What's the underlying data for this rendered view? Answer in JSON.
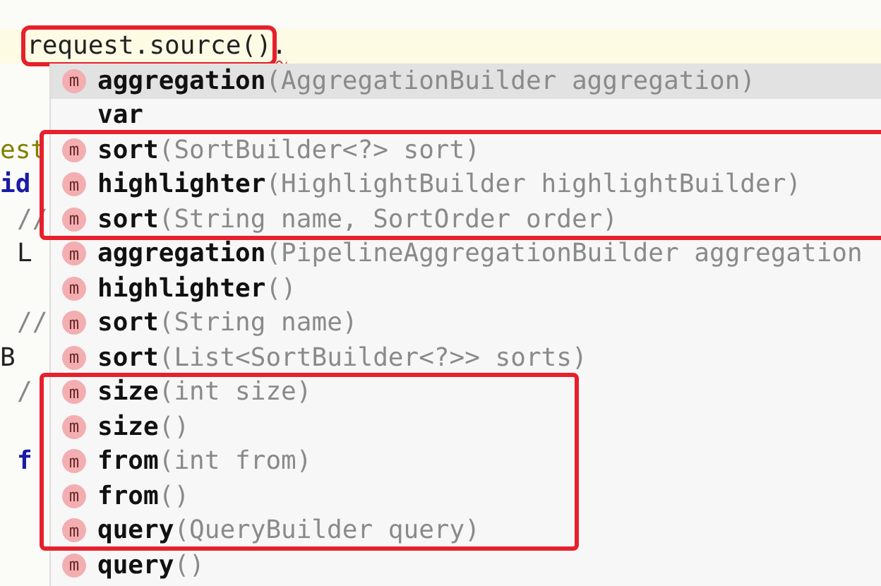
{
  "editor": {
    "current_line": {
      "outlined_text": "request.source()",
      "trailing_text": ".",
      "error": true
    },
    "lines": [
      {
        "kind": "blank"
      },
      {
        "kind": "blank"
      },
      {
        "text": "est",
        "kind": "identifier",
        "indented": false
      },
      {
        "text": "id",
        "kind": "keyword",
        "indented": false
      },
      {
        "text": "//",
        "kind": "comment",
        "indented": true
      },
      {
        "text": "L",
        "kind": "plain",
        "indented": true
      },
      {
        "kind": "blank"
      },
      {
        "text": "//",
        "kind": "comment",
        "indented": true
      },
      {
        "text": "B",
        "kind": "plain",
        "indented": false
      },
      {
        "text": "/",
        "kind": "comment",
        "indented": true
      },
      {
        "kind": "blank"
      },
      {
        "text": "f",
        "kind": "keyword",
        "indented": true
      }
    ]
  },
  "completion_popup": {
    "groups": [
      {
        "outlined": false,
        "items": [
          {
            "kind": "method",
            "icon_letter": "m",
            "name": "aggregation",
            "params": "(AggregationBuilder aggregation)",
            "selected": true
          },
          {
            "kind": "keyword",
            "name": "var",
            "selected": false
          }
        ]
      },
      {
        "outlined": true,
        "items": [
          {
            "kind": "method",
            "icon_letter": "m",
            "name": "sort",
            "params": "(SortBuilder<?> sort)",
            "selected": false
          },
          {
            "kind": "method",
            "icon_letter": "m",
            "name": "highlighter",
            "params": "(HighlightBuilder highlightBuilder)",
            "selected": false
          },
          {
            "kind": "method",
            "icon_letter": "m",
            "name": "sort",
            "params": "(String name, SortOrder order)",
            "selected": false
          }
        ]
      },
      {
        "outlined": false,
        "items": [
          {
            "kind": "method",
            "icon_letter": "m",
            "name": "aggregation",
            "params": "(PipelineAggregationBuilder aggregation",
            "selected": false
          },
          {
            "kind": "method",
            "icon_letter": "m",
            "name": "highlighter",
            "params": "()",
            "selected": false
          },
          {
            "kind": "method",
            "icon_letter": "m",
            "name": "sort",
            "params": "(String name)",
            "selected": false
          },
          {
            "kind": "method",
            "icon_letter": "m",
            "name": "sort",
            "params": "(List<SortBuilder<?>> sorts)",
            "selected": false
          }
        ]
      },
      {
        "outlined": true,
        "items": [
          {
            "kind": "method",
            "icon_letter": "m",
            "name": "size",
            "params": "(int size)",
            "selected": false
          },
          {
            "kind": "method",
            "icon_letter": "m",
            "name": "size",
            "params": "()",
            "selected": false
          },
          {
            "kind": "method",
            "icon_letter": "m",
            "name": "from",
            "params": "(int from)",
            "selected": false
          },
          {
            "kind": "method",
            "icon_letter": "m",
            "name": "from",
            "params": "()",
            "selected": false
          },
          {
            "kind": "method",
            "icon_letter": "m",
            "name": "query",
            "params": "(QueryBuilder query)",
            "selected": false
          }
        ]
      },
      {
        "outlined": false,
        "items": [
          {
            "kind": "method",
            "icon_letter": "m",
            "name": "query",
            "params": "()",
            "selected": false
          }
        ]
      }
    ]
  }
}
